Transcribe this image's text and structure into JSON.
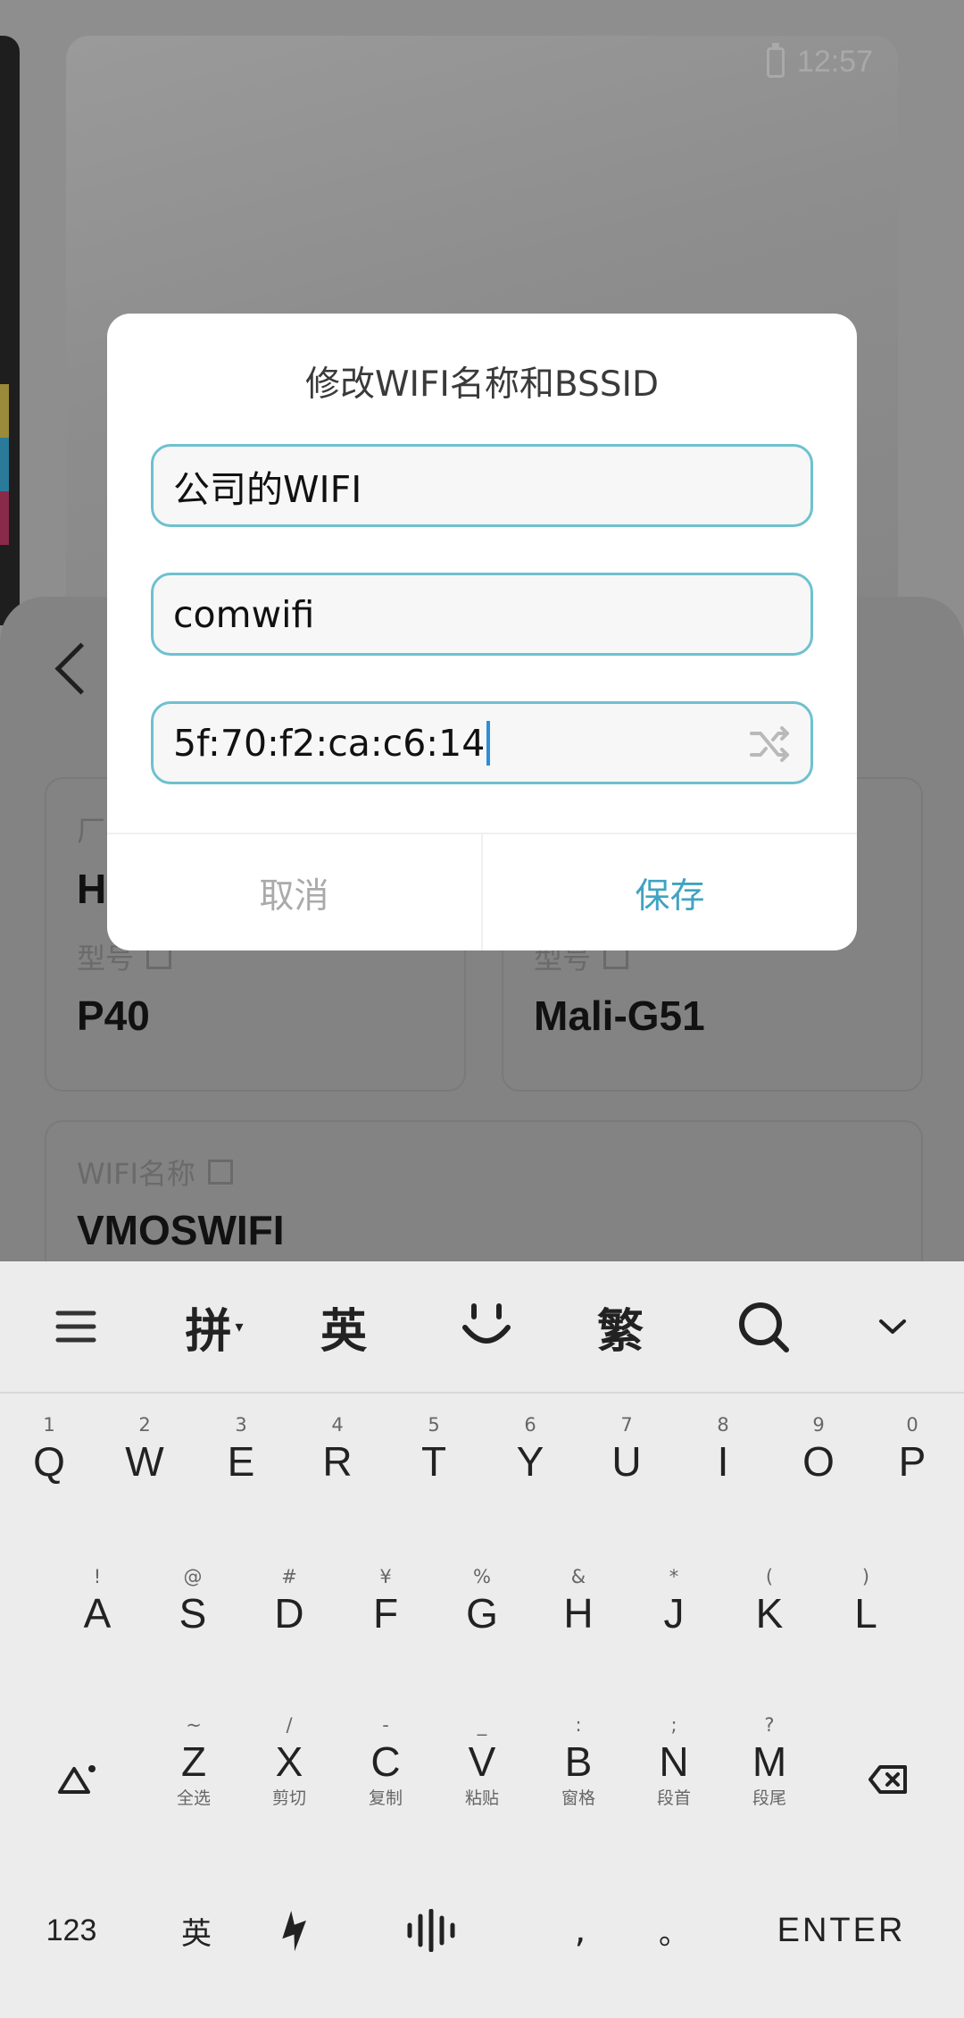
{
  "status_bar": {
    "time": "12:57",
    "battery_icon": "battery-icon"
  },
  "background": {
    "cards": [
      {
        "label": "厂",
        "value": "H"
      },
      {
        "label": "型号",
        "value": "P40"
      },
      {
        "label": "型号",
        "value": "Mali-G51"
      },
      {
        "label": "WIFI名称",
        "value": "VMOSWIFI"
      }
    ]
  },
  "dialog": {
    "title": "修改WIFI名称和BSSID",
    "wifi_name": "公司的WIFI",
    "ssid": "comwifi",
    "bssid": "5f:70:f2:ca:c6:14",
    "cancel": "取消",
    "save": "保存",
    "colors": {
      "field_border": "#6ec1cf",
      "save": "#3fa3c3",
      "cancel": "#aaaaaa"
    }
  },
  "keyboard": {
    "toolbar": [
      "拼",
      "英",
      "繁"
    ],
    "row1": [
      {
        "k": "Q",
        "h": "1"
      },
      {
        "k": "W",
        "h": "2"
      },
      {
        "k": "E",
        "h": "3"
      },
      {
        "k": "R",
        "h": "4"
      },
      {
        "k": "T",
        "h": "5"
      },
      {
        "k": "Y",
        "h": "6"
      },
      {
        "k": "U",
        "h": "7"
      },
      {
        "k": "I",
        "h": "8"
      },
      {
        "k": "O",
        "h": "9"
      },
      {
        "k": "P",
        "h": "0"
      }
    ],
    "row2": [
      {
        "k": "A",
        "h": "!"
      },
      {
        "k": "S",
        "h": "@"
      },
      {
        "k": "D",
        "h": "#"
      },
      {
        "k": "F",
        "h": "¥"
      },
      {
        "k": "G",
        "h": "%"
      },
      {
        "k": "H",
        "h": "&"
      },
      {
        "k": "J",
        "h": "*"
      },
      {
        "k": "K",
        "h": "("
      },
      {
        "k": "L",
        "h": ")"
      }
    ],
    "row3": [
      {
        "k": "Z",
        "h": "~",
        "s": "全选"
      },
      {
        "k": "X",
        "h": "/",
        "s": "剪切"
      },
      {
        "k": "C",
        "h": "-",
        "s": "复制"
      },
      {
        "k": "V",
        "h": "_",
        "s": "粘贴"
      },
      {
        "k": "B",
        "h": ":",
        "s": "窗格"
      },
      {
        "k": "N",
        "h": ";",
        "s": "段首"
      },
      {
        "k": "M",
        "h": "?",
        "s": "段尾"
      }
    ],
    "bottom": {
      "num": "123",
      "lang": "英",
      "comma": ",",
      "period": "。",
      "enter": "ENTER"
    }
  }
}
